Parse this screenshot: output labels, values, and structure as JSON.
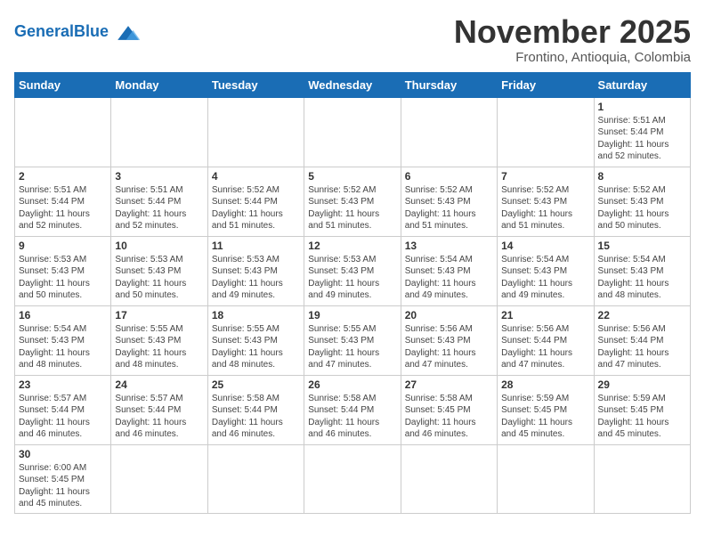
{
  "header": {
    "logo_general": "General",
    "logo_blue": "Blue",
    "month_title": "November 2025",
    "subtitle": "Frontino, Antioquia, Colombia"
  },
  "weekdays": [
    "Sunday",
    "Monday",
    "Tuesday",
    "Wednesday",
    "Thursday",
    "Friday",
    "Saturday"
  ],
  "weeks": [
    [
      {
        "day": "",
        "info": ""
      },
      {
        "day": "",
        "info": ""
      },
      {
        "day": "",
        "info": ""
      },
      {
        "day": "",
        "info": ""
      },
      {
        "day": "",
        "info": ""
      },
      {
        "day": "",
        "info": ""
      },
      {
        "day": "1",
        "info": "Sunrise: 5:51 AM\nSunset: 5:44 PM\nDaylight: 11 hours\nand 52 minutes."
      }
    ],
    [
      {
        "day": "2",
        "info": "Sunrise: 5:51 AM\nSunset: 5:44 PM\nDaylight: 11 hours\nand 52 minutes."
      },
      {
        "day": "3",
        "info": "Sunrise: 5:51 AM\nSunset: 5:44 PM\nDaylight: 11 hours\nand 52 minutes."
      },
      {
        "day": "4",
        "info": "Sunrise: 5:52 AM\nSunset: 5:44 PM\nDaylight: 11 hours\nand 51 minutes."
      },
      {
        "day": "5",
        "info": "Sunrise: 5:52 AM\nSunset: 5:43 PM\nDaylight: 11 hours\nand 51 minutes."
      },
      {
        "day": "6",
        "info": "Sunrise: 5:52 AM\nSunset: 5:43 PM\nDaylight: 11 hours\nand 51 minutes."
      },
      {
        "day": "7",
        "info": "Sunrise: 5:52 AM\nSunset: 5:43 PM\nDaylight: 11 hours\nand 51 minutes."
      },
      {
        "day": "8",
        "info": "Sunrise: 5:52 AM\nSunset: 5:43 PM\nDaylight: 11 hours\nand 50 minutes."
      }
    ],
    [
      {
        "day": "9",
        "info": "Sunrise: 5:53 AM\nSunset: 5:43 PM\nDaylight: 11 hours\nand 50 minutes."
      },
      {
        "day": "10",
        "info": "Sunrise: 5:53 AM\nSunset: 5:43 PM\nDaylight: 11 hours\nand 50 minutes."
      },
      {
        "day": "11",
        "info": "Sunrise: 5:53 AM\nSunset: 5:43 PM\nDaylight: 11 hours\nand 49 minutes."
      },
      {
        "day": "12",
        "info": "Sunrise: 5:53 AM\nSunset: 5:43 PM\nDaylight: 11 hours\nand 49 minutes."
      },
      {
        "day": "13",
        "info": "Sunrise: 5:54 AM\nSunset: 5:43 PM\nDaylight: 11 hours\nand 49 minutes."
      },
      {
        "day": "14",
        "info": "Sunrise: 5:54 AM\nSunset: 5:43 PM\nDaylight: 11 hours\nand 49 minutes."
      },
      {
        "day": "15",
        "info": "Sunrise: 5:54 AM\nSunset: 5:43 PM\nDaylight: 11 hours\nand 48 minutes."
      }
    ],
    [
      {
        "day": "16",
        "info": "Sunrise: 5:54 AM\nSunset: 5:43 PM\nDaylight: 11 hours\nand 48 minutes."
      },
      {
        "day": "17",
        "info": "Sunrise: 5:55 AM\nSunset: 5:43 PM\nDaylight: 11 hours\nand 48 minutes."
      },
      {
        "day": "18",
        "info": "Sunrise: 5:55 AM\nSunset: 5:43 PM\nDaylight: 11 hours\nand 48 minutes."
      },
      {
        "day": "19",
        "info": "Sunrise: 5:55 AM\nSunset: 5:43 PM\nDaylight: 11 hours\nand 47 minutes."
      },
      {
        "day": "20",
        "info": "Sunrise: 5:56 AM\nSunset: 5:43 PM\nDaylight: 11 hours\nand 47 minutes."
      },
      {
        "day": "21",
        "info": "Sunrise: 5:56 AM\nSunset: 5:44 PM\nDaylight: 11 hours\nand 47 minutes."
      },
      {
        "day": "22",
        "info": "Sunrise: 5:56 AM\nSunset: 5:44 PM\nDaylight: 11 hours\nand 47 minutes."
      }
    ],
    [
      {
        "day": "23",
        "info": "Sunrise: 5:57 AM\nSunset: 5:44 PM\nDaylight: 11 hours\nand 46 minutes."
      },
      {
        "day": "24",
        "info": "Sunrise: 5:57 AM\nSunset: 5:44 PM\nDaylight: 11 hours\nand 46 minutes."
      },
      {
        "day": "25",
        "info": "Sunrise: 5:58 AM\nSunset: 5:44 PM\nDaylight: 11 hours\nand 46 minutes."
      },
      {
        "day": "26",
        "info": "Sunrise: 5:58 AM\nSunset: 5:44 PM\nDaylight: 11 hours\nand 46 minutes."
      },
      {
        "day": "27",
        "info": "Sunrise: 5:58 AM\nSunset: 5:45 PM\nDaylight: 11 hours\nand 46 minutes."
      },
      {
        "day": "28",
        "info": "Sunrise: 5:59 AM\nSunset: 5:45 PM\nDaylight: 11 hours\nand 45 minutes."
      },
      {
        "day": "29",
        "info": "Sunrise: 5:59 AM\nSunset: 5:45 PM\nDaylight: 11 hours\nand 45 minutes."
      }
    ],
    [
      {
        "day": "30",
        "info": "Sunrise: 6:00 AM\nSunset: 5:45 PM\nDaylight: 11 hours\nand 45 minutes."
      },
      {
        "day": "",
        "info": ""
      },
      {
        "day": "",
        "info": ""
      },
      {
        "day": "",
        "info": ""
      },
      {
        "day": "",
        "info": ""
      },
      {
        "day": "",
        "info": ""
      },
      {
        "day": "",
        "info": ""
      }
    ]
  ]
}
